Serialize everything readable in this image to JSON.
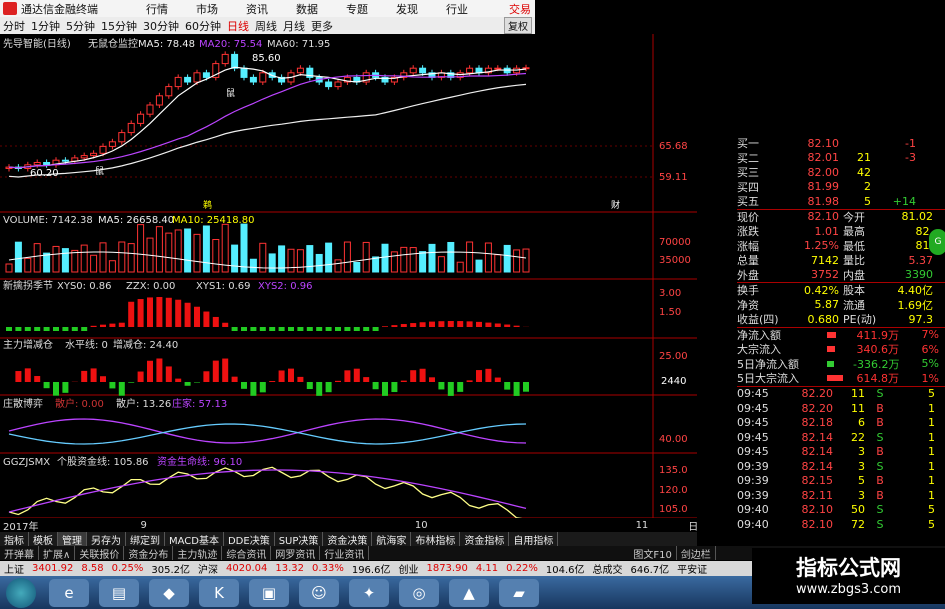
{
  "titlebar": {
    "app_title": "通达信金融终端",
    "menu": [
      "行情",
      "市场",
      "资讯",
      "数据",
      "专题",
      "发现",
      "行业",
      "交易"
    ],
    "trade": "交易"
  },
  "periods": {
    "items": [
      "分时",
      "1分钟",
      "5分钟",
      "15分钟",
      "30分钟",
      "60分钟",
      "日线",
      "周线",
      "月线",
      "更多"
    ],
    "active": "日线",
    "restore": "复权"
  },
  "main_panel": {
    "title": "先导智能(日线)",
    "overlay": "无鼠仓监控",
    "ma5": "MA5: 78.48",
    "ma20": "MA20: 75.54",
    "ma60": "MA60: 71.95",
    "peak_label": "85.60",
    "low_label": "60.20",
    "ticks": [
      "65.68",
      "59.11"
    ],
    "marker1": "鼠",
    "marker2": "鼠",
    "marker3": "鼠",
    "marker4": "鹈",
    "marker5": "财"
  },
  "volume_panel": {
    "label": "VOLUME: 7142.38",
    "ma5": "MA5: 26658.40",
    "ma10": "MA10: 25418.80",
    "ticks": [
      "70000",
      "35000"
    ]
  },
  "season_panel": {
    "label": "新擒拐季节",
    "xys0": "XYS0: 0.86",
    "zzx": "ZZX: 0.00",
    "xys1": "XYS1: 0.69",
    "xys2": "XYS2: 0.96",
    "ticks": [
      "3.00",
      "1.50"
    ]
  },
  "capital_panel": {
    "label": "主力增减仓",
    "level": "水平线: 0",
    "delta": "增减仓: 24.40",
    "tick": "25.00",
    "right_value": "2440"
  },
  "game_panel": {
    "label": "庄散博弈",
    "retail": "散户: 0.00",
    "retail2": "散户: 13.26",
    "dealer": "庄家: 57.13",
    "tick": "40.00"
  },
  "fund_panel": {
    "label": "GGZJSMX",
    "stock": "个股资金线: 105.86",
    "life": "资金生命线: 96.10",
    "ticks": [
      "135.0",
      "120.0",
      "105.0"
    ]
  },
  "x_axis": {
    "year": "2017年",
    "m9": "9",
    "m10": "10",
    "m11": "11",
    "daily": "日线"
  },
  "tabs1": [
    "指标",
    "模板",
    "管理",
    "另存为",
    "绑定到",
    "MACD基本",
    "DDE决策",
    "SUP决策",
    "资金决策",
    "航海家",
    "布林指标",
    "资金指标",
    "自用指标"
  ],
  "tabs2": [
    "开弹幕",
    "扩展∧",
    "关联报价",
    "资金分布",
    "主力轨迹",
    "综合资讯",
    "网罗资讯",
    "行业资讯",
    "图文F10",
    "剑边栏"
  ],
  "indexbar": [
    {
      "name": "上证",
      "val": "3401.92",
      "chg": "8.58",
      "pct": "0.25%",
      "amt": "305.2亿"
    },
    {
      "name": "沪深",
      "val": "4020.04",
      "chg": "13.32",
      "pct": "0.33%",
      "amt": "196.6亿"
    },
    {
      "name": "创业",
      "val": "1873.90",
      "chg": "4.11",
      "pct": "0.22%",
      "amt": "104.6亿"
    }
  ],
  "indexbar_extra": {
    "total": "总成交",
    "total_v": "646.7亿",
    "safe": "平安证"
  },
  "quotes": [
    {
      "name": "买一",
      "price": "82.10",
      "vol": "",
      "chg": "-1"
    },
    {
      "name": "买二",
      "price": "82.01",
      "vol": "21",
      "chg": "-3"
    },
    {
      "name": "买三",
      "price": "82.00",
      "vol": "42",
      "chg": ""
    },
    {
      "name": "买四",
      "price": "81.99",
      "vol": "2",
      "chg": ""
    },
    {
      "name": "买五",
      "price": "81.98",
      "vol": "5",
      "chg": "+14"
    }
  ],
  "stats": [
    {
      "k": "现价",
      "v": "82.10",
      "k2": "今开",
      "v2": "81.02"
    },
    {
      "k": "涨跌",
      "v": "1.01",
      "k2": "最高",
      "v2": "82."
    },
    {
      "k": "涨幅",
      "v": "1.25%",
      "k2": "最低",
      "v2": "81."
    },
    {
      "k": "总量",
      "v": "7142",
      "k2": "量比",
      "v2": "5.37"
    },
    {
      "k": "外盘",
      "v": "3752",
      "k2": "内盘",
      "v2": "3390"
    }
  ],
  "stats2": [
    {
      "k": "换手",
      "v": "0.42%",
      "k2": "股本",
      "v2": "4.40亿"
    },
    {
      "k": "净资",
      "v": "5.87",
      "k2": "流通",
      "v2": "1.69亿"
    },
    {
      "k": "收益(四)",
      "v": "0.680",
      "k2": "PE(动)",
      "v2": "97.3"
    }
  ],
  "flows": [
    {
      "k": "净流入额",
      "v": "411.9万",
      "p": "7%",
      "w": 0.35,
      "c": "#f33"
    },
    {
      "k": "大宗流入",
      "v": "340.6万",
      "p": "6%",
      "w": 0.3,
      "c": "#f33"
    },
    {
      "k": "5日净流入额",
      "v": "-336.2万",
      "p": "5%",
      "w": 0.25,
      "c": "#3c3"
    },
    {
      "k": "5日大宗流入",
      "v": "614.8万",
      "p": "1%",
      "w": 0.6,
      "c": "#f33"
    }
  ],
  "ticks_list": [
    {
      "t": "09:45",
      "p": "82.20",
      "n": "11",
      "s": "S",
      "x": "5"
    },
    {
      "t": "09:45",
      "p": "82.20",
      "n": "11",
      "s": "B",
      "x": "1"
    },
    {
      "t": "09:45",
      "p": "82.18",
      "n": "6",
      "s": "B",
      "x": "1"
    },
    {
      "t": "09:45",
      "p": "82.14",
      "n": "22",
      "s": "S",
      "x": "1"
    },
    {
      "t": "09:45",
      "p": "82.14",
      "n": "3",
      "s": "B",
      "x": "1"
    },
    {
      "t": "09:39",
      "p": "82.14",
      "n": "3",
      "s": "S",
      "x": "1"
    },
    {
      "t": "09:39",
      "p": "82.15",
      "n": "5",
      "s": "B",
      "x": "1"
    },
    {
      "t": "09:39",
      "p": "82.11",
      "n": "3",
      "s": "B",
      "x": "1"
    },
    {
      "t": "09:40",
      "p": "82.10",
      "n": "50",
      "s": "S",
      "x": "5"
    },
    {
      "t": "09:40",
      "p": "82.10",
      "n": "72",
      "s": "S",
      "x": "5"
    }
  ],
  "watermark": {
    "title": "指标公式网",
    "url": "www.zbgs3.com"
  },
  "side_button": "G"
}
